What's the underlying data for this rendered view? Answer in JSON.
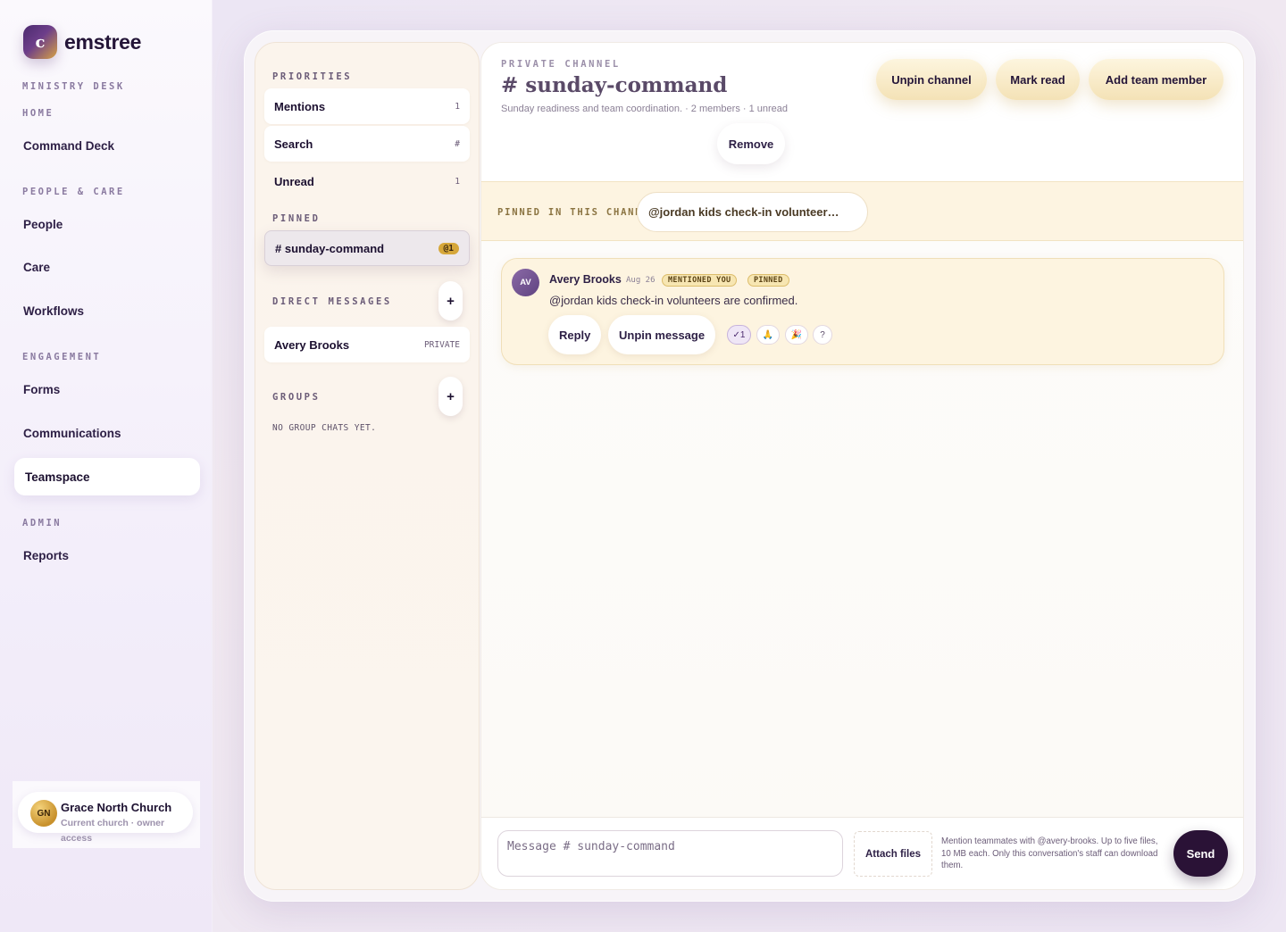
{
  "app": {
    "brand": "emstree",
    "logo_letter": "c"
  },
  "nav": {
    "workspace_label": "MINISTRY DESK",
    "sections": [
      {
        "title": "HOME",
        "items": [
          "Command Deck"
        ]
      },
      {
        "title": "PEOPLE & CARE",
        "items": [
          "People",
          "Care",
          "Workflows"
        ]
      },
      {
        "title": "ENGAGEMENT",
        "items": [
          "Forms",
          "Communications",
          "Teamspace"
        ]
      },
      {
        "title": "ADMIN",
        "items": [
          "Reports"
        ]
      }
    ],
    "active_item": "Teamspace"
  },
  "org": {
    "initials": "GN",
    "name": "Grace North Church",
    "subtitle": "Current church · owner access"
  },
  "channels_panel": {
    "priorities_title": "PRIORITIES",
    "priorities": [
      {
        "label": "Mentions",
        "meta": "1"
      },
      {
        "label": "Search",
        "meta": "#"
      },
      {
        "label": "Unread",
        "meta": "1"
      }
    ],
    "pinned_title": "PINNED",
    "pinned": [
      {
        "label": "# sunday-command",
        "badge": "@1"
      }
    ],
    "dm_title": "DIRECT MESSAGES",
    "dms": [
      {
        "label": "Avery Brooks",
        "meta": "PRIVATE"
      }
    ],
    "groups_title": "GROUPS",
    "groups_empty": "NO GROUP CHATS YET.",
    "add_symbol": "+"
  },
  "channel": {
    "eyebrow": "PRIVATE CHANNEL",
    "title": "# sunday-command",
    "description": "Sunday readiness and team coordination. · 2 members · 1 unread",
    "actions": {
      "unpin": "Unpin channel",
      "mark_read": "Mark read",
      "add_member": "Add team member",
      "remove": "Remove"
    }
  },
  "pinned_bar": {
    "label": "PINNED IN THIS CHANNEL",
    "chip": "@jordan kids check-in volunteer…"
  },
  "messages": [
    {
      "avatar": "AV",
      "author": "Avery Brooks",
      "date": "Aug 26",
      "tags": [
        "MENTIONED YOU",
        "PINNED"
      ],
      "text": "@jordan kids check-in volunteers are confirmed.",
      "actions": [
        "Reply",
        "Unpin message"
      ],
      "reactions": [
        "✓1",
        "🙏",
        "🎉",
        "?"
      ]
    }
  ],
  "composer": {
    "placeholder": "Message # sunday-command",
    "attach_label": "Attach files",
    "hint": "Mention teammates with @avery-brooks. Up to five files, 10 MB each. Only this conversation's staff can download them.",
    "send_label": "Send"
  },
  "colors": {
    "accent_dark": "#2a1236",
    "gold": "#d6a73a",
    "brand_purple": "#4b2a6e"
  }
}
